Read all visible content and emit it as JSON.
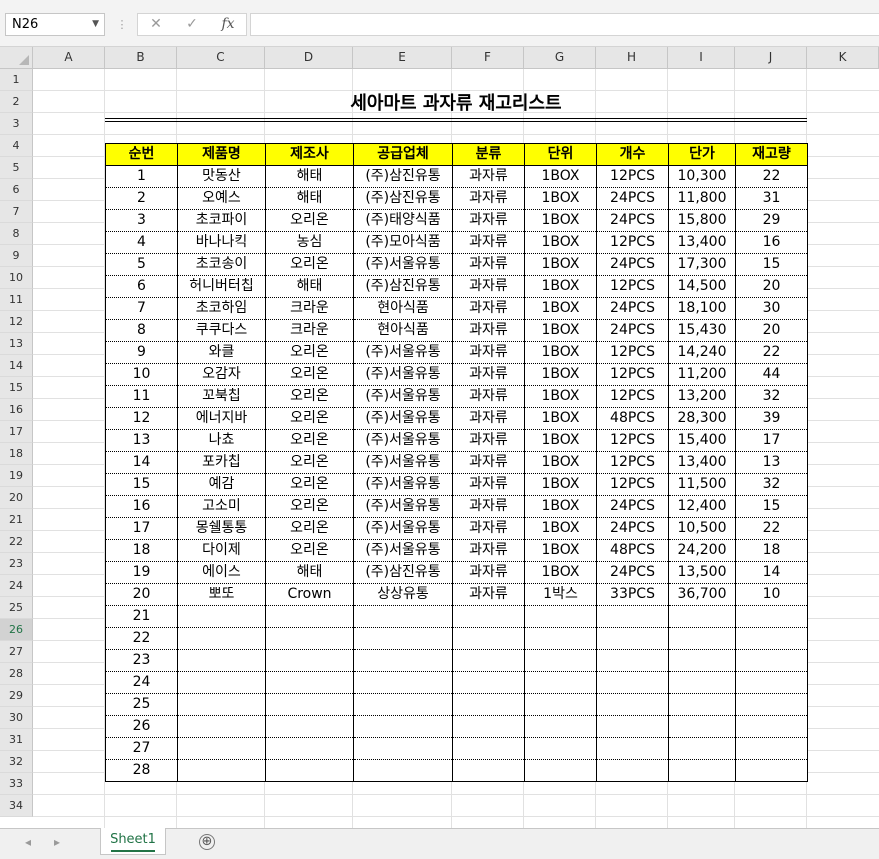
{
  "name_box": "N26",
  "formula_icons": {
    "cancel": "✕",
    "enter": "✓",
    "fx": "fx"
  },
  "columns": [
    "A",
    "B",
    "C",
    "D",
    "E",
    "F",
    "G",
    "H",
    "I",
    "J",
    "K"
  ],
  "rows": [
    "1",
    "2",
    "3",
    "4",
    "5",
    "6",
    "7",
    "8",
    "9",
    "10",
    "11",
    "12",
    "13",
    "14",
    "15",
    "16",
    "17",
    "18",
    "19",
    "20",
    "21",
    "22",
    "23",
    "24",
    "25",
    "26",
    "27",
    "28",
    "29",
    "30",
    "31",
    "32",
    "33",
    "34"
  ],
  "active_row": "26",
  "title": "세아마트 과자류 재고리스트",
  "headers": [
    "순번",
    "제품명",
    "제조사",
    "공급업체",
    "분류",
    "단위",
    "개수",
    "단가",
    "재고량"
  ],
  "records": [
    [
      "1",
      "맛동산",
      "해태",
      "(주)삼진유통",
      "과자류",
      "1BOX",
      "12PCS",
      "10,300",
      "22"
    ],
    [
      "2",
      "오예스",
      "해태",
      "(주)삼진유통",
      "과자류",
      "1BOX",
      "24PCS",
      "11,800",
      "31"
    ],
    [
      "3",
      "초코파이",
      "오리온",
      "(주)태양식품",
      "과자류",
      "1BOX",
      "24PCS",
      "15,800",
      "29"
    ],
    [
      "4",
      "바나나킥",
      "농심",
      "(주)모아식품",
      "과자류",
      "1BOX",
      "12PCS",
      "13,400",
      "16"
    ],
    [
      "5",
      "초코송이",
      "오리온",
      "(주)서울유통",
      "과자류",
      "1BOX",
      "24PCS",
      "17,300",
      "15"
    ],
    [
      "6",
      "허니버터칩",
      "해태",
      "(주)삼진유통",
      "과자류",
      "1BOX",
      "12PCS",
      "14,500",
      "20"
    ],
    [
      "7",
      "초코하임",
      "크라운",
      "현아식품",
      "과자류",
      "1BOX",
      "24PCS",
      "18,100",
      "30"
    ],
    [
      "8",
      "쿠쿠다스",
      "크라운",
      "현아식품",
      "과자류",
      "1BOX",
      "24PCS",
      "15,430",
      "20"
    ],
    [
      "9",
      "와클",
      "오리온",
      "(주)서울유통",
      "과자류",
      "1BOX",
      "12PCS",
      "14,240",
      "22"
    ],
    [
      "10",
      "오감자",
      "오리온",
      "(주)서울유통",
      "과자류",
      "1BOX",
      "12PCS",
      "11,200",
      "44"
    ],
    [
      "11",
      "꼬북칩",
      "오리온",
      "(주)서울유통",
      "과자류",
      "1BOX",
      "12PCS",
      "13,200",
      "32"
    ],
    [
      "12",
      "에너지바",
      "오리온",
      "(주)서울유통",
      "과자류",
      "1BOX",
      "48PCS",
      "28,300",
      "39"
    ],
    [
      "13",
      "나쵸",
      "오리온",
      "(주)서울유통",
      "과자류",
      "1BOX",
      "12PCS",
      "15,400",
      "17"
    ],
    [
      "14",
      "포카칩",
      "오리온",
      "(주)서울유통",
      "과자류",
      "1BOX",
      "12PCS",
      "13,400",
      "13"
    ],
    [
      "15",
      "예감",
      "오리온",
      "(주)서울유통",
      "과자류",
      "1BOX",
      "12PCS",
      "11,500",
      "32"
    ],
    [
      "16",
      "고소미",
      "오리온",
      "(주)서울유통",
      "과자류",
      "1BOX",
      "24PCS",
      "12,400",
      "15"
    ],
    [
      "17",
      "몽쉘통통",
      "오리온",
      "(주)서울유통",
      "과자류",
      "1BOX",
      "24PCS",
      "10,500",
      "22"
    ],
    [
      "18",
      "다이제",
      "오리온",
      "(주)서울유통",
      "과자류",
      "1BOX",
      "48PCS",
      "24,200",
      "18"
    ],
    [
      "19",
      "에이스",
      "해태",
      "(주)삼진유통",
      "과자류",
      "1BOX",
      "24PCS",
      "13,500",
      "14"
    ],
    [
      "20",
      "뽀또",
      "Crown",
      "상상유통",
      "과자류",
      "1박스",
      "33PCS",
      "36,700",
      "10"
    ],
    [
      "21",
      "",
      "",
      "",
      "",
      "",
      "",
      "",
      ""
    ],
    [
      "22",
      "",
      "",
      "",
      "",
      "",
      "",
      "",
      ""
    ],
    [
      "23",
      "",
      "",
      "",
      "",
      "",
      "",
      "",
      ""
    ],
    [
      "24",
      "",
      "",
      "",
      "",
      "",
      "",
      "",
      ""
    ],
    [
      "25",
      "",
      "",
      "",
      "",
      "",
      "",
      "",
      ""
    ],
    [
      "26",
      "",
      "",
      "",
      "",
      "",
      "",
      "",
      ""
    ],
    [
      "27",
      "",
      "",
      "",
      "",
      "",
      "",
      "",
      ""
    ],
    [
      "28",
      "",
      "",
      "",
      "",
      "",
      "",
      "",
      ""
    ]
  ],
  "sheet_tab": "Sheet1",
  "add_sheet_icon": "⊕"
}
